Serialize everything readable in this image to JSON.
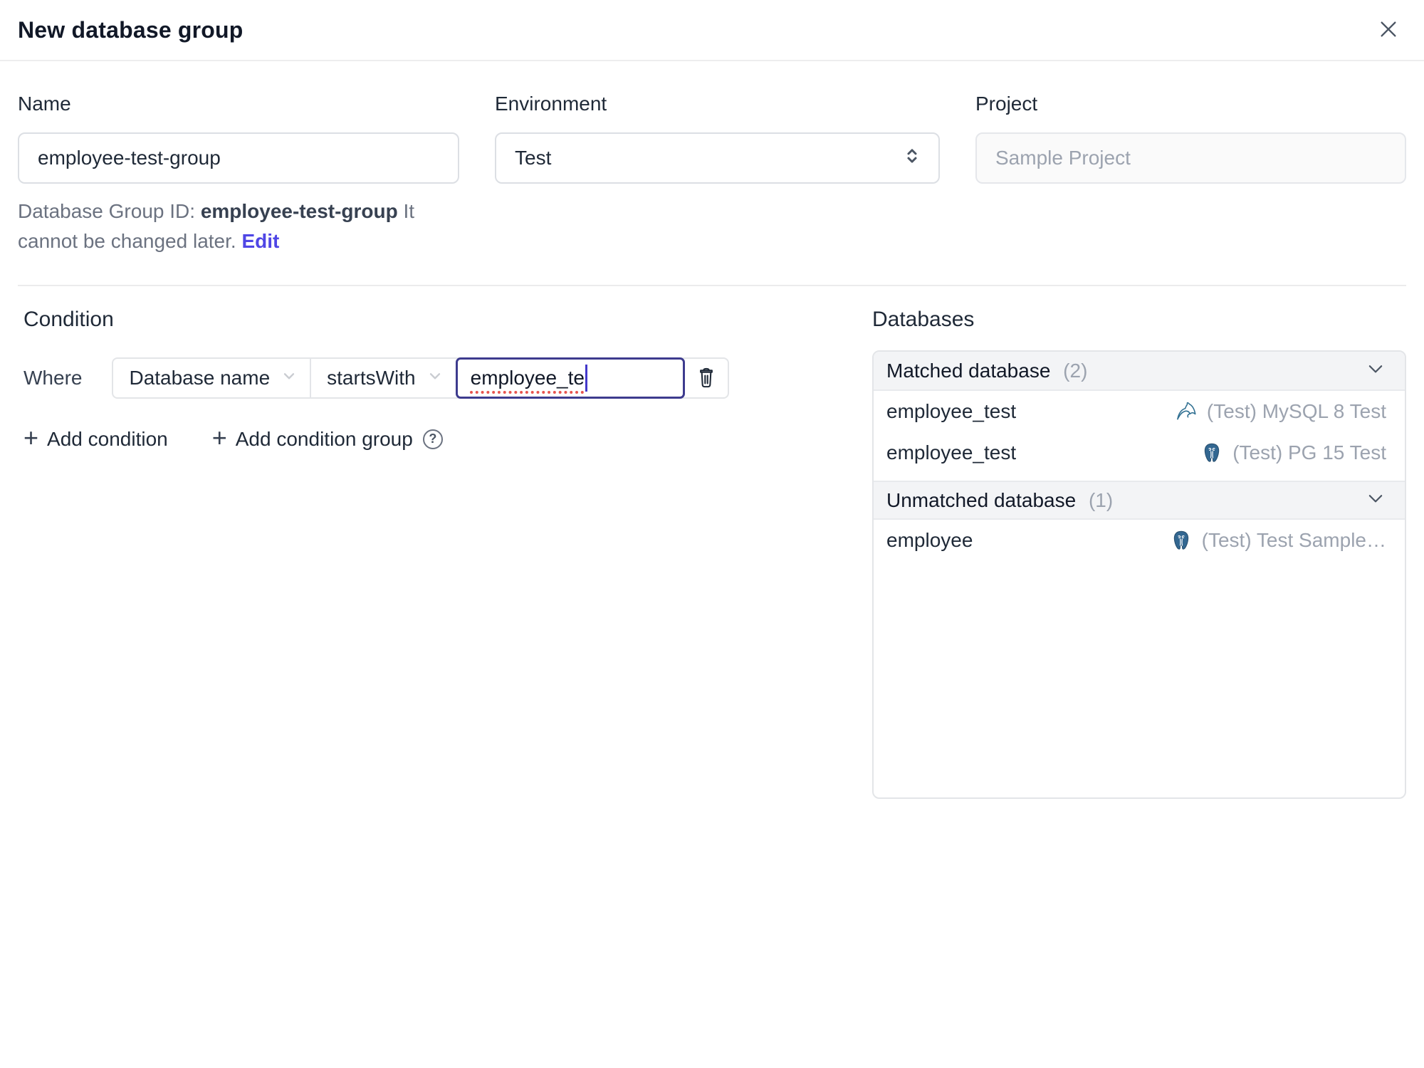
{
  "dialog": {
    "title": "New database group"
  },
  "form": {
    "name": {
      "label": "Name",
      "value": "employee-test-group"
    },
    "environment": {
      "label": "Environment",
      "value": "Test"
    },
    "project": {
      "label": "Project",
      "value": "Sample Project"
    },
    "group_id_hint": {
      "prefix": "Database Group ID: ",
      "id": "employee-test-group",
      "suffix": " It cannot be changed later. ",
      "edit_label": "Edit"
    }
  },
  "condition": {
    "heading": "Condition",
    "where_label": "Where",
    "factor": "Database name",
    "operator": "startsWith",
    "value": "employee_te",
    "add_condition_label": "Add condition",
    "add_condition_group_label": "Add condition group",
    "help_glyph": "?",
    "plus_glyph": "+"
  },
  "databases": {
    "heading": "Databases",
    "sections": [
      {
        "title": "Matched database",
        "count": "(2)",
        "rows": [
          {
            "name": "employee_test",
            "engine": "mysql",
            "instance": "(Test) MySQL 8 Test"
          },
          {
            "name": "employee_test",
            "engine": "postgres",
            "instance": "(Test) PG 15 Test"
          }
        ]
      },
      {
        "title": "Unmatched database",
        "count": "(1)",
        "rows": [
          {
            "name": "employee",
            "engine": "postgres",
            "instance": "(Test) Test Sample…"
          }
        ]
      }
    ]
  },
  "colors": {
    "accent": "#4f46e5",
    "focus_border": "#3d3b8e",
    "text_dark": "#1f2937",
    "text_gray": "#6b7280",
    "text_light": "#9ca3af",
    "border": "#e3e5e8",
    "section_header_bg": "#f3f4f6",
    "spellcheck_red": "#e8554f",
    "mysql_icon": "#2f6f91",
    "postgres_icon": "#336791"
  }
}
